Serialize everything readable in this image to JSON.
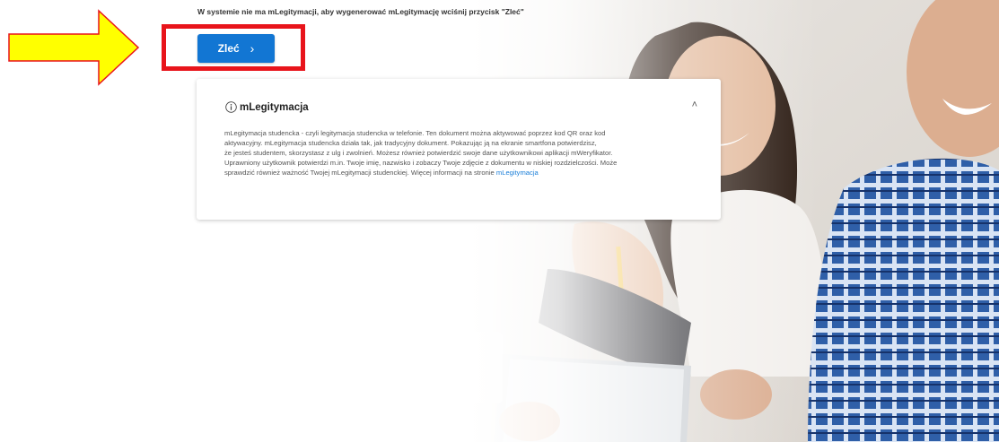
{
  "instruction": "W systemie nie ma mLegitymacji, aby wygenerować mLegitymację wciśnij przycisk \"Zleć\"",
  "order_button": {
    "label": "Zleć",
    "icon": "chevron-right-icon",
    "chevron": "›"
  },
  "annotation": {
    "arrow_color": "#ffff00",
    "arrow_outline": "#e8141b",
    "highlight_color": "#e8141b"
  },
  "card": {
    "title": "mLegitymacja",
    "title_icon": "info-icon",
    "collapse_icon": "chevron-up-icon",
    "collapse_glyph": "˄",
    "body_lines": [
      "mLegitymacja studencka - czyli legitymacja studencka w telefonie. Ten dokument można aktywować poprzez kod QR oraz kod",
      "aktywacyjny. mLegitymacja studencka działa tak, jak tradycyjny dokument. Pokazując ją na ekranie smartfona potwierdzisz,",
      "że jesteś studentem, skorzystasz z ulg i zwolnień. Możesz również potwierdzić swoje dane użytkownikowi aplikacji mWeryfikator.",
      "Uprawniony użytkownik potwierdzi m.in. Twoje imię, nazwisko i zobaczy Twoje zdjęcie z dokumentu w niskiej rozdzielczości. Może",
      "sprawdzić również ważność Twojej mLegitymacji studenckiej. Więcej informacji na stronie "
    ],
    "link_text": "mLegitymacja"
  },
  "colors": {
    "button_blue": "#1276d3",
    "link_blue": "#1a7ed8",
    "text_gray": "#555555"
  }
}
